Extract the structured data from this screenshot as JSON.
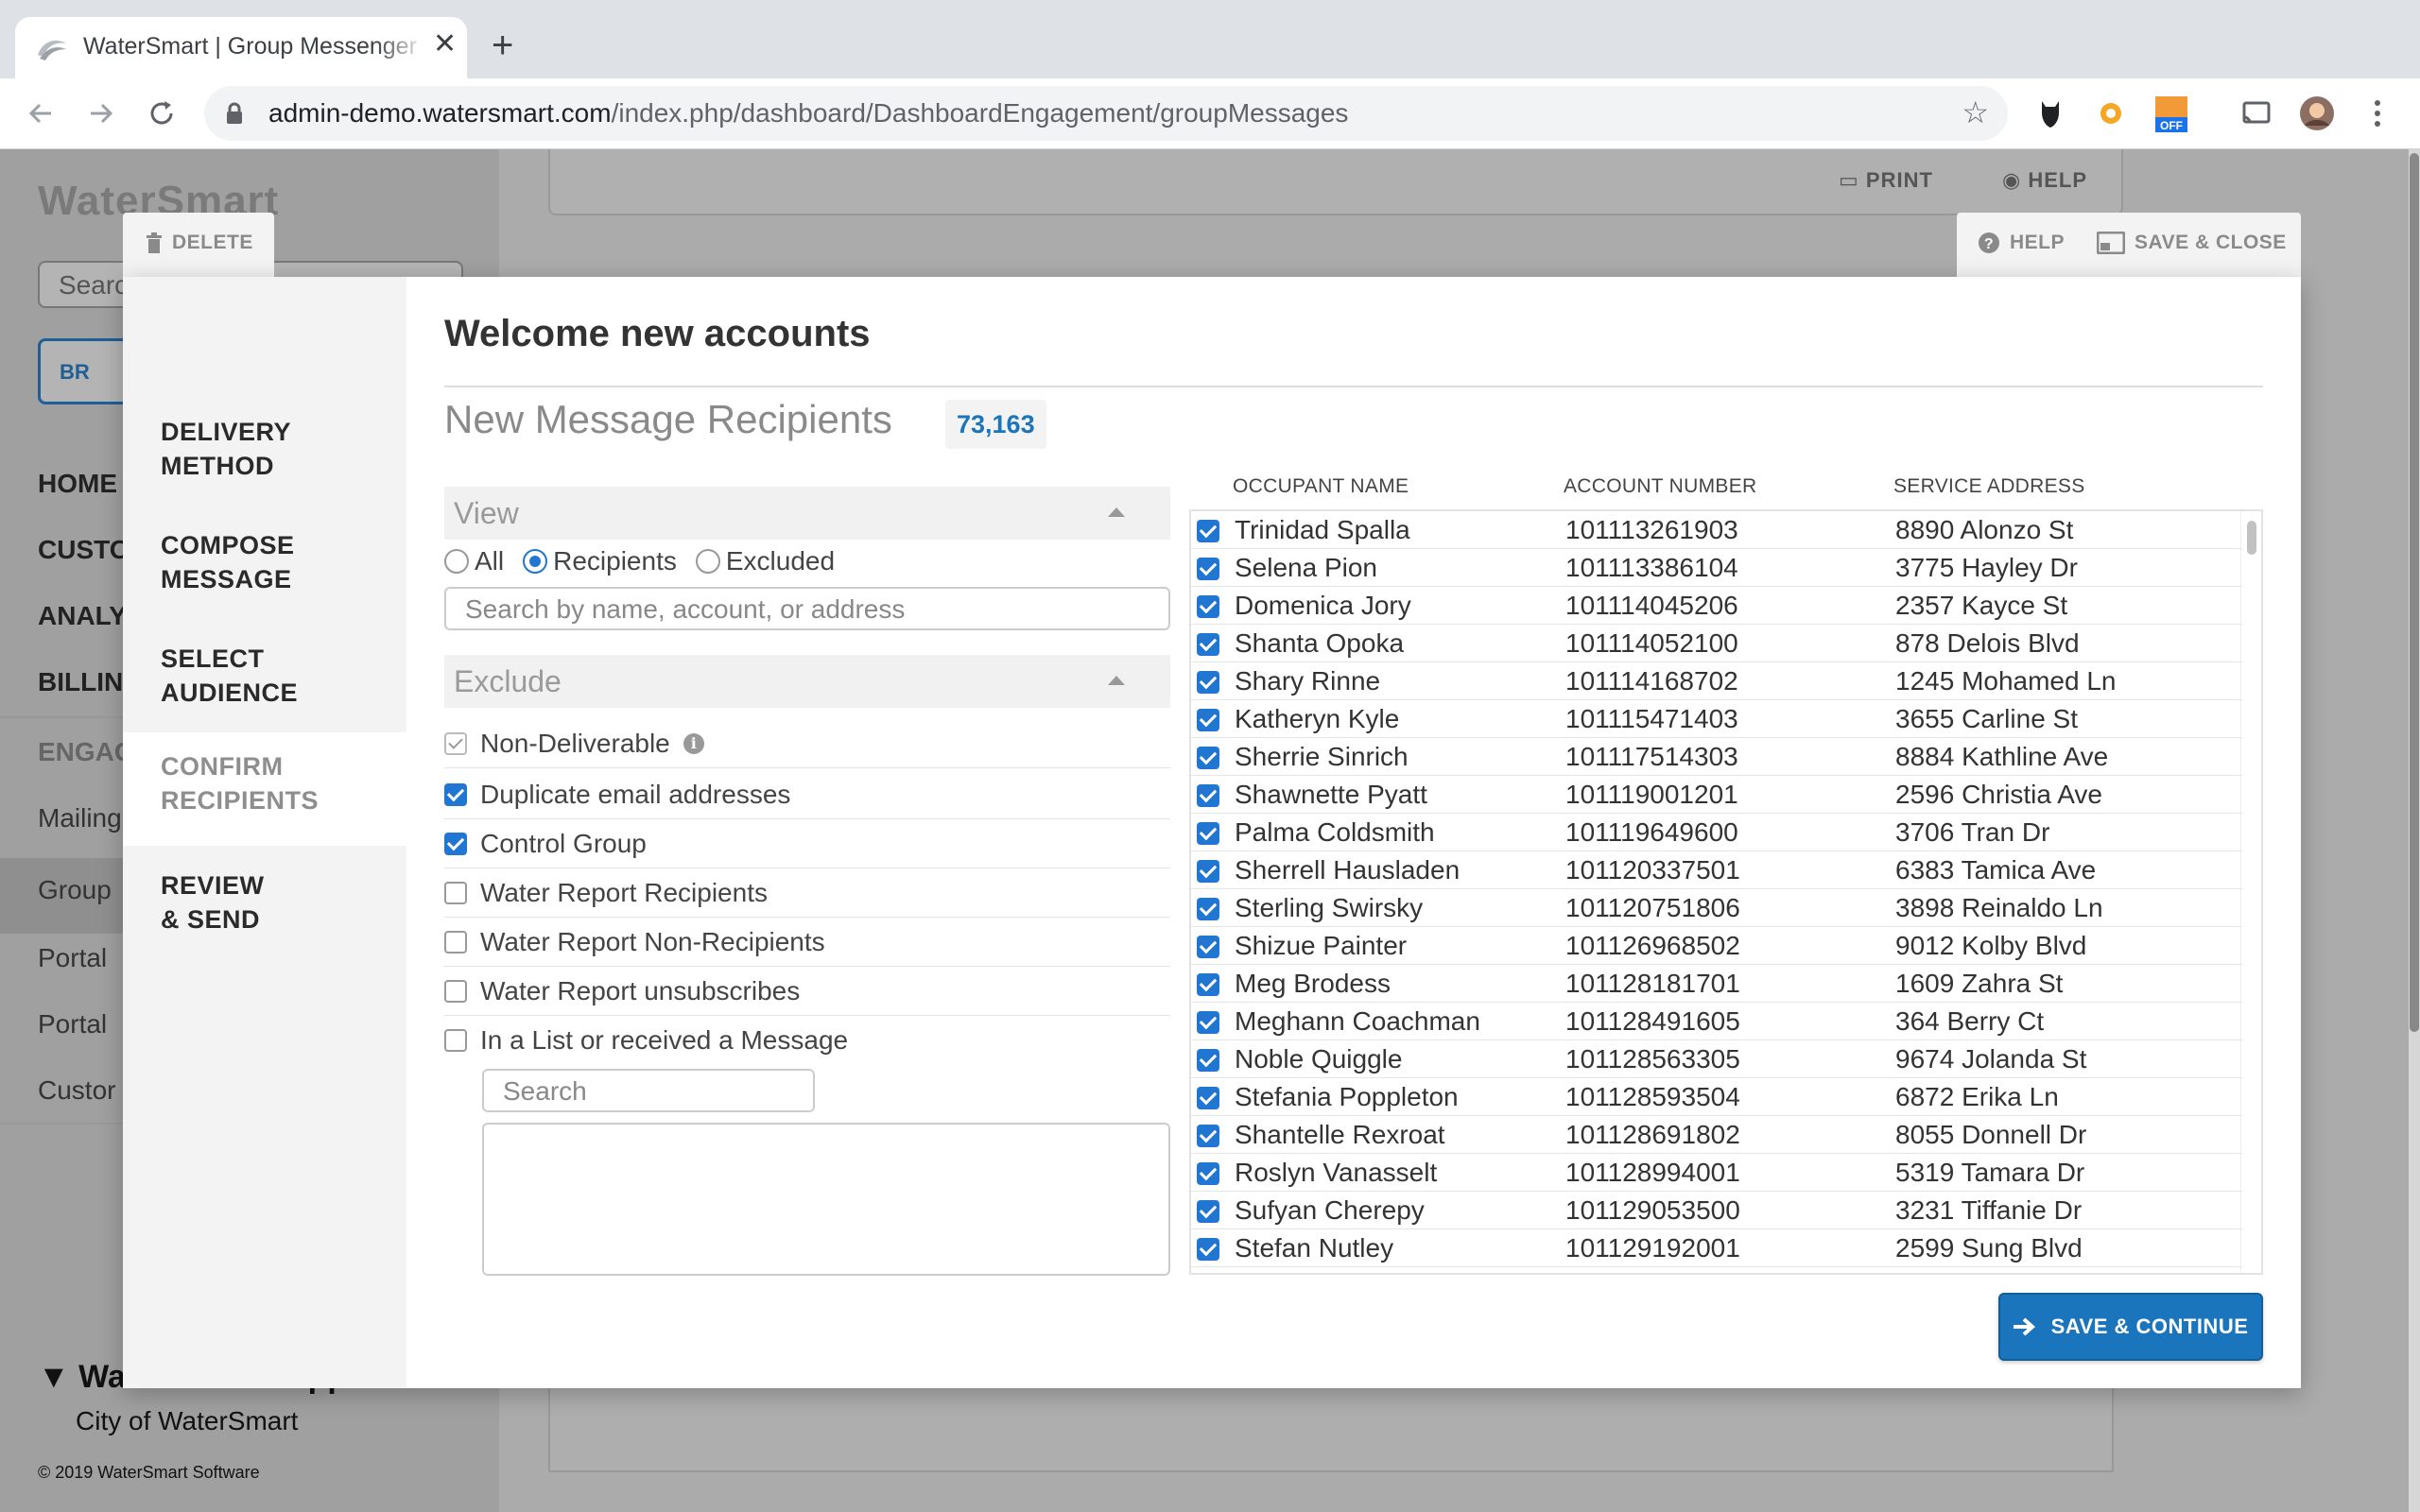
{
  "browser": {
    "tab_title": "WaterSmart | Group Messenger",
    "url_host": "admin-demo.watersmart.com",
    "url_path": "/index.php/dashboard/DashboardEngagement/groupMessages",
    "extension_badge": "OFF"
  },
  "background": {
    "logo": "WaterSmart",
    "search_placeholder": "Search",
    "browse_label": "BR",
    "nav": [
      "HOME",
      "CUSTO",
      "ANALY",
      "BILLIN"
    ],
    "section": "ENGAG",
    "sub_nav": [
      "Mailing",
      "Group",
      "Portal",
      "Portal",
      "Custor"
    ],
    "support_name": "WaterSmart Support",
    "city": "City of WaterSmart",
    "copyright": "© 2019 WaterSmart Software",
    "print_label": "PRINT",
    "help_label": "HELP"
  },
  "modal": {
    "delete_label": "DELETE",
    "help_label": "HELP",
    "save_close_label": "SAVE & CLOSE",
    "steps": [
      {
        "line1": "DELIVERY",
        "line2": "METHOD"
      },
      {
        "line1": "COMPOSE",
        "line2": "MESSAGE"
      },
      {
        "line1": "SELECT",
        "line2": "AUDIENCE"
      },
      {
        "line1": "CONFIRM",
        "line2": "RECIPIENTS"
      },
      {
        "line1": "REVIEW",
        "line2": "& SEND"
      }
    ],
    "active_step": 3,
    "title": "Welcome new accounts",
    "subtitle": "New Message Recipients",
    "count": "73,163",
    "view": {
      "heading": "View",
      "options": [
        "All",
        "Recipients",
        "Excluded"
      ],
      "selected": "Recipients",
      "search_placeholder": "Search by name, account, or address"
    },
    "exclude": {
      "heading": "Exclude",
      "items": [
        {
          "label": "Non-Deliverable",
          "checked": true,
          "disabled": true,
          "info": true
        },
        {
          "label": "Duplicate email addresses",
          "checked": true
        },
        {
          "label": "Control Group",
          "checked": true
        },
        {
          "label": "Water Report Recipients",
          "checked": false
        },
        {
          "label": "Water Report Non-Recipients",
          "checked": false
        },
        {
          "label": "Water Report unsubscribes",
          "checked": false
        },
        {
          "label": "In a List or received a Message",
          "checked": false
        }
      ],
      "list_search_placeholder": "Search"
    },
    "table": {
      "columns": [
        "OCCUPANT NAME",
        "ACCOUNT NUMBER",
        "SERVICE ADDRESS"
      ],
      "rows": [
        [
          "Trinidad Spalla",
          "101113261903",
          "8890 Alonzo St"
        ],
        [
          "Selena Pion",
          "101113386104",
          "3775 Hayley Dr"
        ],
        [
          "Domenica Jory",
          "101114045206",
          "2357 Kayce St"
        ],
        [
          "Shanta Opoka",
          "101114052100",
          "878 Delois Blvd"
        ],
        [
          "Shary Rinne",
          "101114168702",
          "1245 Mohamed Ln"
        ],
        [
          "Katheryn Kyle",
          "101115471403",
          "3655 Carline St"
        ],
        [
          "Sherrie Sinrich",
          "101117514303",
          "8884 Kathline Ave"
        ],
        [
          "Shawnette Pyatt",
          "101119001201",
          "2596 Christia Ave"
        ],
        [
          "Palma Coldsmith",
          "101119649600",
          "3706 Tran Dr"
        ],
        [
          "Sherrell Hausladen",
          "101120337501",
          "6383 Tamica Ave"
        ],
        [
          "Sterling Swirsky",
          "101120751806",
          "3898 Reinaldo Ln"
        ],
        [
          "Shizue Painter",
          "101126968502",
          "9012 Kolby Blvd"
        ],
        [
          "Meg Brodess",
          "101128181701",
          "1609 Zahra St"
        ],
        [
          "Meghann Coachman",
          "101128491605",
          "364 Berry Ct"
        ],
        [
          "Noble Quiggle",
          "101128563305",
          "9674 Jolanda St"
        ],
        [
          "Stefania Poppleton",
          "101128593504",
          "6872 Erika Ln"
        ],
        [
          "Shantelle Rexroat",
          "101128691802",
          "8055 Donnell Dr"
        ],
        [
          "Roslyn Vanasselt",
          "101128994001",
          "5319 Tamara Dr"
        ],
        [
          "Sufyan Cherepy",
          "101129053500",
          "3231 Tiffanie Dr"
        ],
        [
          "Stefan Nutley",
          "101129192001",
          "2599 Sung Blvd"
        ]
      ]
    },
    "save_continue_label": "SAVE & CONTINUE"
  },
  "colors": {
    "accent": "#1a75bc",
    "checkbox": "#2176d2"
  }
}
